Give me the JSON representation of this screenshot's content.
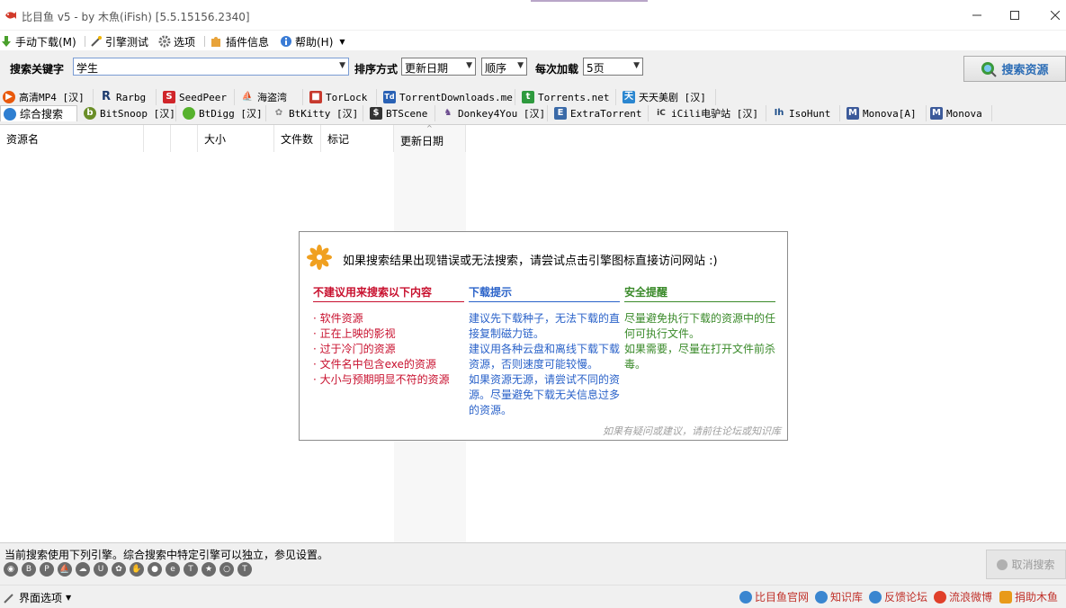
{
  "window": {
    "title": "比目鱼 v5 - by 木魚(iFish) [5.5.15156.2340]"
  },
  "menu": {
    "manual_download": "手动下载(M)",
    "engine_test": "引擎测试",
    "options": "选项",
    "plugin_info": "插件信息",
    "help": "帮助(H)"
  },
  "search": {
    "keyword_label": "搜索关键字",
    "keyword_value": "学生",
    "sort_label": "排序方式",
    "sort_value": "更新日期",
    "order_value": "顺序",
    "per_load_label": "每次加载",
    "per_load_value": "5页",
    "search_button": "搜索资源"
  },
  "engines_row1": [
    {
      "label": "高清MP4 [汉]",
      "icon": "play-icon",
      "color": "#e8590c"
    },
    {
      "label": "Rarbg",
      "icon": "rarbg-icon",
      "color": "#1d3b6e"
    },
    {
      "label": "SeedPeer",
      "icon": "seedpeer-icon",
      "color": "#d0252a"
    },
    {
      "label": "海盗湾",
      "icon": "pirate-ship-icon",
      "color": "#333333"
    },
    {
      "label": "TorLock",
      "icon": "torlock-icon",
      "color": "#c73a2e"
    },
    {
      "label": "TorrentDownloads.me",
      "icon": "td-icon",
      "color": "#2a62b5"
    },
    {
      "label": "Torrents.net",
      "icon": "torrents-icon",
      "color": "#2e9a3e"
    },
    {
      "label": "天天美剧 [汉]",
      "icon": "meiju-icon",
      "color": "#2a86d0"
    }
  ],
  "engines_row2": [
    {
      "label": "综合搜索",
      "icon": "globe-icon",
      "color": "#2f7fd1"
    },
    {
      "label": "BitSnoop [汉]",
      "icon": "bitsnoop-icon",
      "color": "#6a8e28"
    },
    {
      "label": "BtDigg [汉]",
      "icon": "btdigg-icon",
      "color": "#56b22d"
    },
    {
      "label": "BtKitty [汉]",
      "icon": "btkitty-icon",
      "color": "#888888"
    },
    {
      "label": "BTScene",
      "icon": "btscene-icon",
      "color": "#333333"
    },
    {
      "label": "Donkey4You [汉]",
      "icon": "donkey-icon",
      "color": "#6a4a8e"
    },
    {
      "label": "ExtraTorrent",
      "icon": "extratorrent-icon",
      "color": "#3a6aa8"
    },
    {
      "label": "iCili电驴站 [汉]",
      "icon": "icili-icon",
      "color": "#333333"
    },
    {
      "label": "IsoHunt",
      "icon": "isohunt-icon",
      "color": "#1f4f8a"
    },
    {
      "label": "Monova[A]",
      "icon": "monova-icon",
      "color": "#3c5a9a"
    },
    {
      "label": "Monova",
      "icon": "monova-icon",
      "color": "#3c5a9a"
    }
  ],
  "columns": [
    "资源名",
    "",
    "",
    "大小",
    "文件数",
    "标记",
    "更新日期"
  ],
  "info": {
    "headline": "如果搜索结果出现错误或无法搜索，请尝试点击引擎图标直接访问网站 :)",
    "col1_title": "不建议用来搜索以下内容",
    "col1_items": [
      "· 软件资源",
      "· 正在上映的影视",
      "· 过于冷门的资源",
      "· 文件名中包含exe的资源",
      "· 大小与预期明显不符的资源"
    ],
    "col2_title": "下载提示",
    "col2_text": "建议先下载种子，无法下载的直接复制磁力链。\n建议用各种云盘和离线下载下载资源，否则速度可能较慢。\n如果资源无源，请尝试不同的资源。尽量避免下载无关信息过多的资源。",
    "col3_title": "安全提醒",
    "col3_text": "尽量避免执行下载的资源中的任何可执行文件。\n如果需要，尽量在打开文件前杀毒。",
    "footer": "如果有疑问或建议，请前往论坛或知识库"
  },
  "status": {
    "note": "当前搜索使用下列引擎。综合搜索中特定引擎可以独立，参见设置。",
    "cancel_button": "取消搜索"
  },
  "bottom": {
    "ui_options": "界面选项",
    "links": [
      "比目鱼官网",
      "知识库",
      "反馈论坛",
      "流浪微博",
      "捐助木鱼"
    ]
  },
  "colors": {
    "accent_red": "#c8102e",
    "accent_blue": "#2a62c9",
    "accent_green": "#3a8a2a",
    "search_button_text": "#2b6cb5"
  }
}
